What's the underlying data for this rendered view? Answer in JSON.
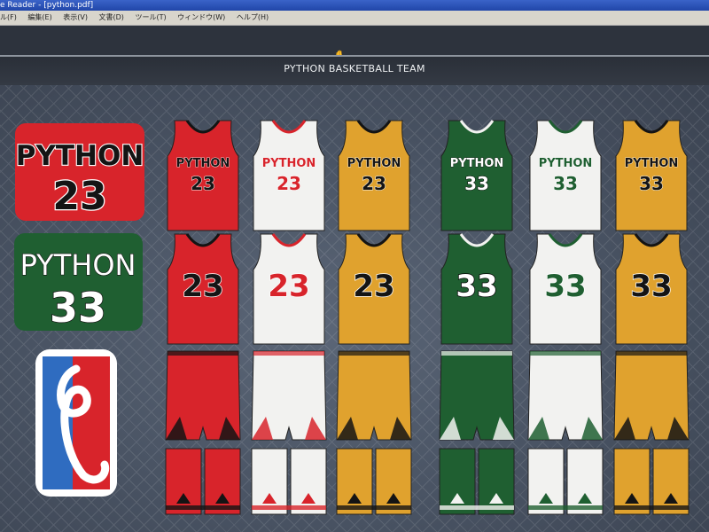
{
  "window": {
    "title": "e Reader - [python.pdf]"
  },
  "menu": {
    "items": [
      "ル(F)",
      "編集(E)",
      "表示(V)",
      "文書(D)",
      "ツール(T)",
      "ウィンドウ(W)",
      "ヘルプ(H)"
    ]
  },
  "banner": {
    "title": "PYTHON BASKETBALL TEAM"
  },
  "team": {
    "wordmark": "PYTHON",
    "number_a": "23",
    "number_b": "33"
  },
  "colors": {
    "red": "#d8242b",
    "white": "#f2f2f0",
    "gold": "#e0a22e",
    "green": "#1f5f31",
    "black": "#141414",
    "logo_blue": "#2f6cc0"
  },
  "uniforms": [
    {
      "color": "red",
      "accent": "black"
    },
    {
      "color": "white",
      "accent": "red"
    },
    {
      "color": "gold",
      "accent": "black"
    },
    {
      "color": "green",
      "accent": "white"
    },
    {
      "color": "white",
      "accent": "green"
    },
    {
      "color": "gold",
      "accent": "black"
    }
  ]
}
